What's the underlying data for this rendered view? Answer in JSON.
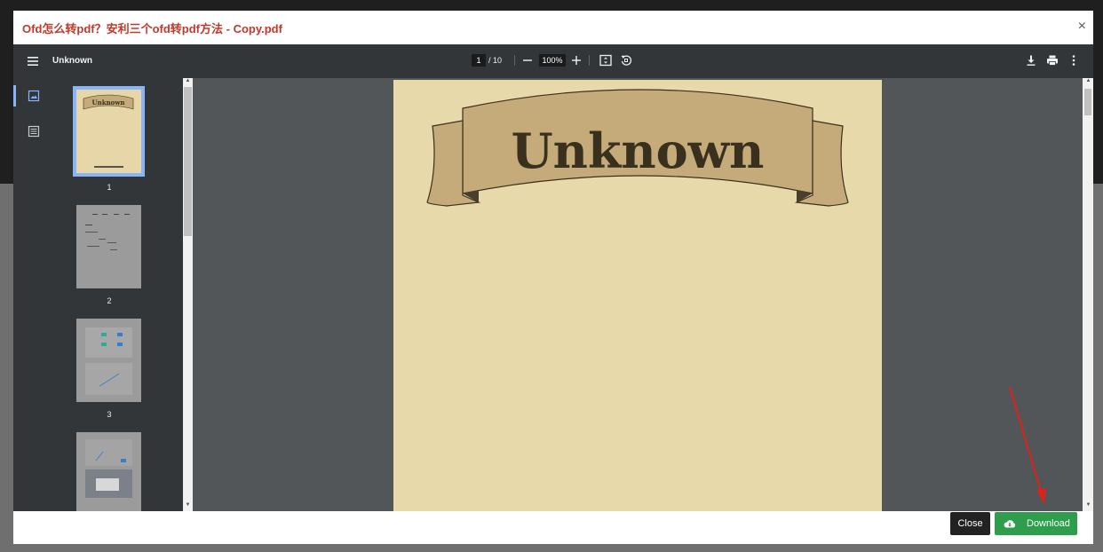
{
  "modal": {
    "title": "Ofd怎么转pdf？安利三个ofd转pdf方法 - Copy.pdf",
    "close_glyph": "×"
  },
  "viewer": {
    "doc_title": "Unknown",
    "current_page": "1",
    "total_pages": "/ 10",
    "zoom": "100%"
  },
  "thumbnails": [
    {
      "label": "1"
    },
    {
      "label": "2"
    },
    {
      "label": "3"
    },
    {
      "label": ""
    }
  ],
  "page": {
    "heading": "Unknown"
  },
  "footer": {
    "close_label": "Close",
    "download_label": "Download"
  },
  "colors": {
    "title_red": "#c0392b",
    "download_green": "#2e9e4d",
    "page_bg": "#e8d9aa",
    "viewer_bg": "#525659",
    "toolbar_bg": "#323639"
  }
}
